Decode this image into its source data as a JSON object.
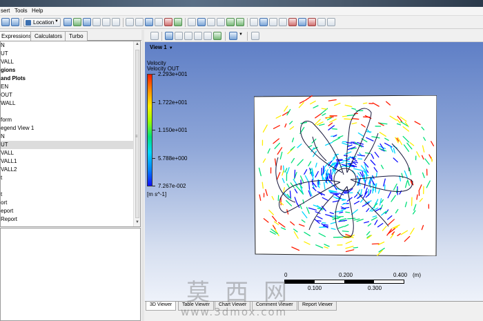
{
  "menu": {
    "insert": "sert",
    "tools": "Tools",
    "help": "Help"
  },
  "toolbar": {
    "location_label": "Location"
  },
  "left_tabs": [
    "Expressions",
    "Calculators",
    "Turbo"
  ],
  "tree_items": [
    {
      "label": "N",
      "bold": false
    },
    {
      "label": "UT",
      "bold": false
    },
    {
      "label": "VALL",
      "bold": false
    },
    {
      "label": "gions",
      "bold": true
    },
    {
      "label": "and Plots",
      "bold": true
    },
    {
      "label": "EN",
      "bold": false
    },
    {
      "label": "OUT",
      "bold": false
    },
    {
      "label": "WALL",
      "bold": false
    },
    {
      "label": "",
      "bold": false
    },
    {
      "label": "form",
      "bold": false
    },
    {
      "label": "egend View 1",
      "bold": false
    },
    {
      "label": "N",
      "bold": false
    },
    {
      "label": "UT",
      "bold": false,
      "selected": true
    },
    {
      "label": "VALL",
      "bold": false
    },
    {
      "label": "VALL1",
      "bold": false
    },
    {
      "label": "VALL2",
      "bold": false
    },
    {
      "label": "t",
      "bold": false
    },
    {
      "label": "",
      "bold": false
    },
    {
      "label": "t",
      "bold": false
    },
    {
      "label": "ort",
      "bold": false
    },
    {
      "label": "eport",
      "bold": false
    },
    {
      "label": "Report",
      "bold": false
    }
  ],
  "viewer": {
    "view_label": "View 1",
    "legend": {
      "title": "Velocity",
      "variable": "Velocity OUT",
      "labels": [
        "2.293e+001",
        "1.722e+001",
        "1.150e+001",
        "5.788e+000",
        "7.267e-002"
      ],
      "unit": "[m s^-1]",
      "colors": [
        "#ff1a00",
        "#ffee00",
        "#00e07a",
        "#00d8ff",
        "#1010ff"
      ]
    },
    "scale": {
      "labels": [
        "0",
        "0.200",
        "0.400",
        "(m)",
        "0.100",
        "0.300"
      ]
    },
    "tabs": [
      "3D Viewer",
      "Table Viewer",
      "Chart Viewer",
      "Comment Viewer",
      "Report Viewer"
    ]
  },
  "watermark": {
    "chinese": "莫西网",
    "url": "www.3dmox.com"
  }
}
